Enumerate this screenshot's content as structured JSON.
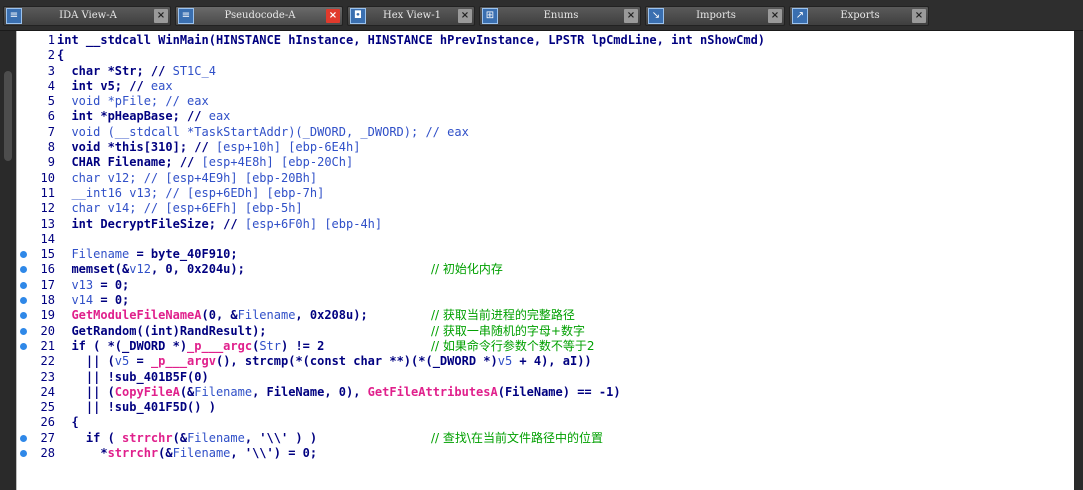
{
  "tabs": [
    {
      "label": "IDA View-A",
      "icon": "ida-view-icon",
      "active": false
    },
    {
      "label": "Pseudocode-A",
      "icon": "pseudocode-icon",
      "active": true
    },
    {
      "label": "Hex View-1",
      "icon": "hex-view-icon",
      "active": false
    },
    {
      "label": "Enums",
      "icon": "enums-icon",
      "active": false
    },
    {
      "label": "Imports",
      "icon": "imports-icon",
      "active": false
    },
    {
      "label": "Exports",
      "icon": "exports-icon",
      "active": false
    }
  ],
  "colors": {
    "code": "#000080",
    "variable": "#3050c8",
    "function_call": "#e0208c",
    "comment": "#00a000",
    "breakpoint": "#2f88e8",
    "active_close": "#e13a2c"
  },
  "lines": [
    {
      "n": "1",
      "bp": false,
      "segs": [
        [
          "int __stdcall WinMain(HINSTANCE hInstance, HINSTANCE hPrevInstance, LPSTR lpCmdLine, int nShowCmd)",
          "c"
        ]
      ],
      "comment": ""
    },
    {
      "n": "2",
      "bp": false,
      "segs": [
        [
          "{",
          "c"
        ]
      ],
      "comment": ""
    },
    {
      "n": "3",
      "bp": false,
      "segs": [
        [
          "  char *Str; // ",
          "c"
        ],
        [
          "ST1C_4",
          "v"
        ]
      ],
      "comment": ""
    },
    {
      "n": "4",
      "bp": false,
      "segs": [
        [
          "  int v5; // ",
          "c"
        ],
        [
          "eax",
          "v"
        ]
      ],
      "comment": ""
    },
    {
      "n": "5",
      "bp": false,
      "segs": [
        [
          "  void *pFile; // eax",
          "v"
        ]
      ],
      "comment": ""
    },
    {
      "n": "6",
      "bp": false,
      "segs": [
        [
          "  int *pHeapBase; // ",
          "c"
        ],
        [
          "eax",
          "v"
        ]
      ],
      "comment": ""
    },
    {
      "n": "7",
      "bp": false,
      "segs": [
        [
          "  void (__stdcall *TaskStartAddr)(_DWORD, _DWORD); // ",
          "v"
        ],
        [
          "eax",
          "v"
        ]
      ],
      "comment": ""
    },
    {
      "n": "8",
      "bp": false,
      "segs": [
        [
          "  void *this[310]; // ",
          "c"
        ],
        [
          "[esp+10h] [ebp-6E4h]",
          "v"
        ]
      ],
      "comment": ""
    },
    {
      "n": "9",
      "bp": false,
      "segs": [
        [
          "  CHAR Filename; // ",
          "c"
        ],
        [
          "[esp+4E8h] [ebp-20Ch]",
          "v"
        ]
      ],
      "comment": ""
    },
    {
      "n": "10",
      "bp": false,
      "segs": [
        [
          "  char v12; // ",
          "v"
        ],
        [
          "[esp+4E9h] [ebp-20Bh]",
          "v"
        ]
      ],
      "comment": ""
    },
    {
      "n": "11",
      "bp": false,
      "segs": [
        [
          "  __int16 v13; // ",
          "v"
        ],
        [
          "[esp+6EDh] [ebp-7h]",
          "v"
        ]
      ],
      "comment": ""
    },
    {
      "n": "12",
      "bp": false,
      "segs": [
        [
          "  char v14; // ",
          "v"
        ],
        [
          "[esp+6EFh] [ebp-5h]",
          "v"
        ]
      ],
      "comment": ""
    },
    {
      "n": "13",
      "bp": false,
      "segs": [
        [
          "  int DecryptFileSize; // ",
          "c"
        ],
        [
          "[esp+6F0h] [ebp-4h]",
          "v"
        ]
      ],
      "comment": ""
    },
    {
      "n": "14",
      "bp": false,
      "segs": [
        [
          "",
          "c"
        ]
      ],
      "comment": ""
    },
    {
      "n": "15",
      "bp": true,
      "segs": [
        [
          "  ",
          "c"
        ],
        [
          "Filename",
          "v"
        ],
        [
          " = byte_40F910;",
          "c"
        ]
      ],
      "comment": ""
    },
    {
      "n": "16",
      "bp": true,
      "segs": [
        [
          "  memset(&",
          "c"
        ],
        [
          "v12",
          "v"
        ],
        [
          ", 0, 0x204u);",
          "c"
        ]
      ],
      "comment": "// 初始化内存"
    },
    {
      "n": "17",
      "bp": true,
      "segs": [
        [
          "  ",
          "c"
        ],
        [
          "v13",
          "v"
        ],
        [
          " = 0;",
          "c"
        ]
      ],
      "comment": ""
    },
    {
      "n": "18",
      "bp": true,
      "segs": [
        [
          "  ",
          "c"
        ],
        [
          "v14",
          "v"
        ],
        [
          " = 0;",
          "c"
        ]
      ],
      "comment": ""
    },
    {
      "n": "19",
      "bp": true,
      "segs": [
        [
          "  ",
          "c"
        ],
        [
          "GetModuleFileNameA",
          "f"
        ],
        [
          "(0, &",
          "c"
        ],
        [
          "Filename",
          "v"
        ],
        [
          ", 0x208u);",
          "c"
        ]
      ],
      "comment": "// 获取当前进程的完整路径"
    },
    {
      "n": "20",
      "bp": true,
      "segs": [
        [
          "  GetRandom((int)RandResult);",
          "c"
        ]
      ],
      "comment": "// 获取一串随机的字母+数字"
    },
    {
      "n": "21",
      "bp": true,
      "segs": [
        [
          "  if ( *(_DWORD *)",
          "c"
        ],
        [
          "_p___argc",
          "f"
        ],
        [
          "(",
          "c"
        ],
        [
          "Str",
          "v"
        ],
        [
          ") != 2",
          "c"
        ]
      ],
      "comment": "// 如果命令行参数个数不等于2"
    },
    {
      "n": "22",
      "bp": false,
      "segs": [
        [
          "    || (",
          "c"
        ],
        [
          "v5",
          "v"
        ],
        [
          " = ",
          "c"
        ],
        [
          "_p___argv",
          "f"
        ],
        [
          "(), strcmp(*(const char **)(*(_DWORD *)",
          "c"
        ],
        [
          "v5",
          "v"
        ],
        [
          " + 4), aI))",
          "c"
        ]
      ],
      "comment": ""
    },
    {
      "n": "23",
      "bp": false,
      "segs": [
        [
          "    || !sub_401B5F(0)",
          "c"
        ]
      ],
      "comment": ""
    },
    {
      "n": "24",
      "bp": false,
      "segs": [
        [
          "    || (",
          "c"
        ],
        [
          "CopyFileA",
          "f"
        ],
        [
          "(&",
          "c"
        ],
        [
          "Filename",
          "v"
        ],
        [
          ", FileName, 0), ",
          "c"
        ],
        [
          "GetFileAttributesA",
          "f"
        ],
        [
          "(FileName) == -1)",
          "c"
        ]
      ],
      "comment": ""
    },
    {
      "n": "25",
      "bp": false,
      "segs": [
        [
          "    || !sub_401F5D() )",
          "c"
        ]
      ],
      "comment": ""
    },
    {
      "n": "26",
      "bp": false,
      "segs": [
        [
          "  {",
          "c"
        ]
      ],
      "comment": ""
    },
    {
      "n": "27",
      "bp": true,
      "segs": [
        [
          "    if ( ",
          "c"
        ],
        [
          "strrchr",
          "f"
        ],
        [
          "(&",
          "c"
        ],
        [
          "Filename",
          "v"
        ],
        [
          ", '\\\\' ) )",
          "c"
        ]
      ],
      "comment": "// 查找\\在当前文件路径中的位置"
    },
    {
      "n": "28",
      "bp": true,
      "segs": [
        [
          "      *",
          "c"
        ],
        [
          "strrchr",
          "f"
        ],
        [
          "(&",
          "c"
        ],
        [
          "Filename",
          "v"
        ],
        [
          ", '\\\\') = 0;",
          "c"
        ]
      ],
      "comment": ""
    }
  ]
}
